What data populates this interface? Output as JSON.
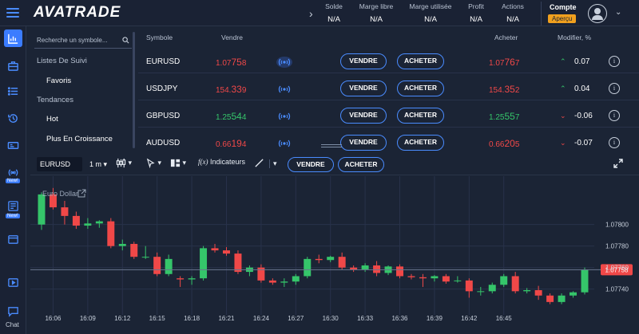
{
  "header": {
    "logo": "AVATRADE",
    "stats": [
      {
        "label": "Solde",
        "value": "N/A"
      },
      {
        "label": "Marge libre",
        "value": "N/A"
      },
      {
        "label": "Marge utilisée",
        "value": "N/A"
      },
      {
        "label": "Profit",
        "value": "N/A"
      },
      {
        "label": "Actions",
        "value": "N/A"
      }
    ],
    "account_label": "Compte",
    "account_mode": "Aperçu"
  },
  "rail": {
    "new_badge": "New!",
    "chat_label": "Chat"
  },
  "watchlist": {
    "search_placeholder": "Recherche un symbole...",
    "items": [
      {
        "label": "Listes De Suivi",
        "kind": "heading"
      },
      {
        "label": "Favoris",
        "kind": "item"
      },
      {
        "label": "Tendances",
        "kind": "heading"
      },
      {
        "label": "Hot",
        "kind": "item"
      },
      {
        "label": "Plus En Croissance",
        "kind": "item"
      }
    ]
  },
  "quotes": {
    "headers": {
      "symbol": "Symbole",
      "sell": "Vendre",
      "buy": "Acheter",
      "change": "Modifier, %"
    },
    "sell_button": "VENDRE",
    "buy_button": "ACHETER",
    "rows": [
      {
        "symbol": "EURUSD",
        "sell_main": "1.07",
        "sell_big": "75",
        "sell_small": "8",
        "buy_main": "1.07",
        "buy_big": "76",
        "buy_small": "7",
        "direction": "up",
        "color": "red",
        "change": "0.07"
      },
      {
        "symbol": "USDJPY",
        "sell_main": "154.",
        "sell_big": "33",
        "sell_small": "9",
        "buy_main": "154.",
        "buy_big": "35",
        "buy_small": "2",
        "direction": "up",
        "color": "red",
        "change": "0.04"
      },
      {
        "symbol": "GBPUSD",
        "sell_main": "1.25",
        "sell_big": "54",
        "sell_small": "4",
        "buy_main": "1.25",
        "buy_big": "55",
        "buy_small": "7",
        "direction": "down",
        "color": "green",
        "change": "-0.06"
      },
      {
        "symbol": "AUDUSD",
        "sell_main": "0.66",
        "sell_big": "19",
        "sell_small": "4",
        "buy_main": "0.66",
        "buy_big": "20",
        "buy_small": "5",
        "direction": "down",
        "color": "red",
        "change": "-0.07"
      }
    ]
  },
  "chart_toolbar": {
    "symbol": "EURUSD",
    "timeframe": "1 m",
    "indicators_label": "Indicateurs",
    "sell_button": "VENDRE",
    "buy_button": "ACHETER"
  },
  "chart_data": {
    "type": "candlestick",
    "title": "Euro Dollar",
    "x_tick_labels": [
      "16:06",
      "16:09",
      "16:12",
      "16:15",
      "16:18",
      "16:21",
      "16:24",
      "16:27",
      "16:30",
      "16:33",
      "16:36",
      "16:39",
      "16:42",
      "16:45"
    ],
    "y_tick_labels": [
      "1.07800",
      "1.07780",
      "1.07760",
      "1.07740"
    ],
    "y_ticks": [
      1.078,
      1.0778,
      1.0776,
      1.0774
    ],
    "ylim": [
      1.07719,
      1.07842
    ],
    "current_price": "1.07758",
    "current_value": 1.07758,
    "colors": {
      "up": "#35c56a",
      "down": "#f04848",
      "price_tag": "#f04848"
    },
    "candles": [
      {
        "o": 1.078,
        "h": 1.0783,
        "l": 1.07795,
        "c": 1.07828
      },
      {
        "o": 1.07828,
        "h": 1.07834,
        "l": 1.07814,
        "c": 1.07816
      },
      {
        "o": 1.07816,
        "h": 1.07822,
        "l": 1.078,
        "c": 1.07808
      },
      {
        "o": 1.07808,
        "h": 1.07812,
        "l": 1.07796,
        "c": 1.07799
      },
      {
        "o": 1.07799,
        "h": 1.07806,
        "l": 1.07796,
        "c": 1.07801
      },
      {
        "o": 1.07801,
        "h": 1.07804,
        "l": 1.07797,
        "c": 1.07803
      },
      {
        "o": 1.07803,
        "h": 1.07806,
        "l": 1.07778,
        "c": 1.0778
      },
      {
        "o": 1.0778,
        "h": 1.07786,
        "l": 1.07776,
        "c": 1.07782
      },
      {
        "o": 1.07782,
        "h": 1.07784,
        "l": 1.07768,
        "c": 1.0777
      },
      {
        "o": 1.0777,
        "h": 1.0778,
        "l": 1.07768,
        "c": 1.0777
      },
      {
        "o": 1.0777,
        "h": 1.07774,
        "l": 1.07752,
        "c": 1.07754
      },
      {
        "o": 1.07754,
        "h": 1.07772,
        "l": 1.07752,
        "c": 1.07768
      },
      {
        "o": 1.0775,
        "h": 1.07752,
        "l": 1.07742,
        "c": 1.07749
      },
      {
        "o": 1.07749,
        "h": 1.07752,
        "l": 1.07744,
        "c": 1.0775
      },
      {
        "o": 1.0775,
        "h": 1.0778,
        "l": 1.07748,
        "c": 1.07778
      },
      {
        "o": 1.07778,
        "h": 1.07782,
        "l": 1.07774,
        "c": 1.07776
      },
      {
        "o": 1.07776,
        "h": 1.07779,
        "l": 1.07771,
        "c": 1.07773
      },
      {
        "o": 1.07773,
        "h": 1.07776,
        "l": 1.07754,
        "c": 1.07756
      },
      {
        "o": 1.07756,
        "h": 1.07762,
        "l": 1.07752,
        "c": 1.0776
      },
      {
        "o": 1.0776,
        "h": 1.07763,
        "l": 1.07746,
        "c": 1.07748
      },
      {
        "o": 1.07748,
        "h": 1.0775,
        "l": 1.07744,
        "c": 1.07746
      },
      {
        "o": 1.07746,
        "h": 1.0775,
        "l": 1.07742,
        "c": 1.07747
      },
      {
        "o": 1.07747,
        "h": 1.07754,
        "l": 1.07744,
        "c": 1.07752
      },
      {
        "o": 1.07752,
        "h": 1.0777,
        "l": 1.0775,
        "c": 1.07768
      },
      {
        "o": 1.07768,
        "h": 1.07772,
        "l": 1.07764,
        "c": 1.07767
      },
      {
        "o": 1.07767,
        "h": 1.07771,
        "l": 1.07765,
        "c": 1.0777
      },
      {
        "o": 1.0777,
        "h": 1.07774,
        "l": 1.07758,
        "c": 1.0776
      },
      {
        "o": 1.0776,
        "h": 1.07762,
        "l": 1.07756,
        "c": 1.07758
      },
      {
        "o": 1.07758,
        "h": 1.07764,
        "l": 1.07756,
        "c": 1.07762
      },
      {
        "o": 1.07762,
        "h": 1.07766,
        "l": 1.07752,
        "c": 1.07755
      },
      {
        "o": 1.07755,
        "h": 1.07762,
        "l": 1.07753,
        "c": 1.07761
      },
      {
        "o": 1.07761,
        "h": 1.07763,
        "l": 1.0775,
        "c": 1.07752
      },
      {
        "o": 1.07752,
        "h": 1.07754,
        "l": 1.07749,
        "c": 1.07751
      },
      {
        "o": 1.07751,
        "h": 1.07754,
        "l": 1.07742,
        "c": 1.0775
      },
      {
        "o": 1.0775,
        "h": 1.07753,
        "l": 1.07747,
        "c": 1.07752
      },
      {
        "o": 1.07752,
        "h": 1.07754,
        "l": 1.07745,
        "c": 1.07747
      },
      {
        "o": 1.07748,
        "h": 1.07752,
        "l": 1.07746,
        "c": 1.07748
      },
      {
        "o": 1.07748,
        "h": 1.0775,
        "l": 1.07732,
        "c": 1.07738
      },
      {
        "o": 1.07738,
        "h": 1.07742,
        "l": 1.07734,
        "c": 1.07738
      },
      {
        "o": 1.07738,
        "h": 1.07746,
        "l": 1.07736,
        "c": 1.07744
      },
      {
        "o": 1.07744,
        "h": 1.07754,
        "l": 1.07742,
        "c": 1.07752
      },
      {
        "o": 1.07752,
        "h": 1.07756,
        "l": 1.07736,
        "c": 1.07738
      },
      {
        "o": 1.07738,
        "h": 1.07741,
        "l": 1.07736,
        "c": 1.07739
      },
      {
        "o": 1.07739,
        "h": 1.07743,
        "l": 1.0773,
        "c": 1.07734
      },
      {
        "o": 1.07734,
        "h": 1.07736,
        "l": 1.07726,
        "c": 1.07728
      },
      {
        "o": 1.07728,
        "h": 1.07736,
        "l": 1.07726,
        "c": 1.07734
      },
      {
        "o": 1.07734,
        "h": 1.07738,
        "l": 1.07732,
        "c": 1.07737
      },
      {
        "o": 1.07737,
        "h": 1.0776,
        "l": 1.07735,
        "c": 1.07758
      }
    ]
  }
}
